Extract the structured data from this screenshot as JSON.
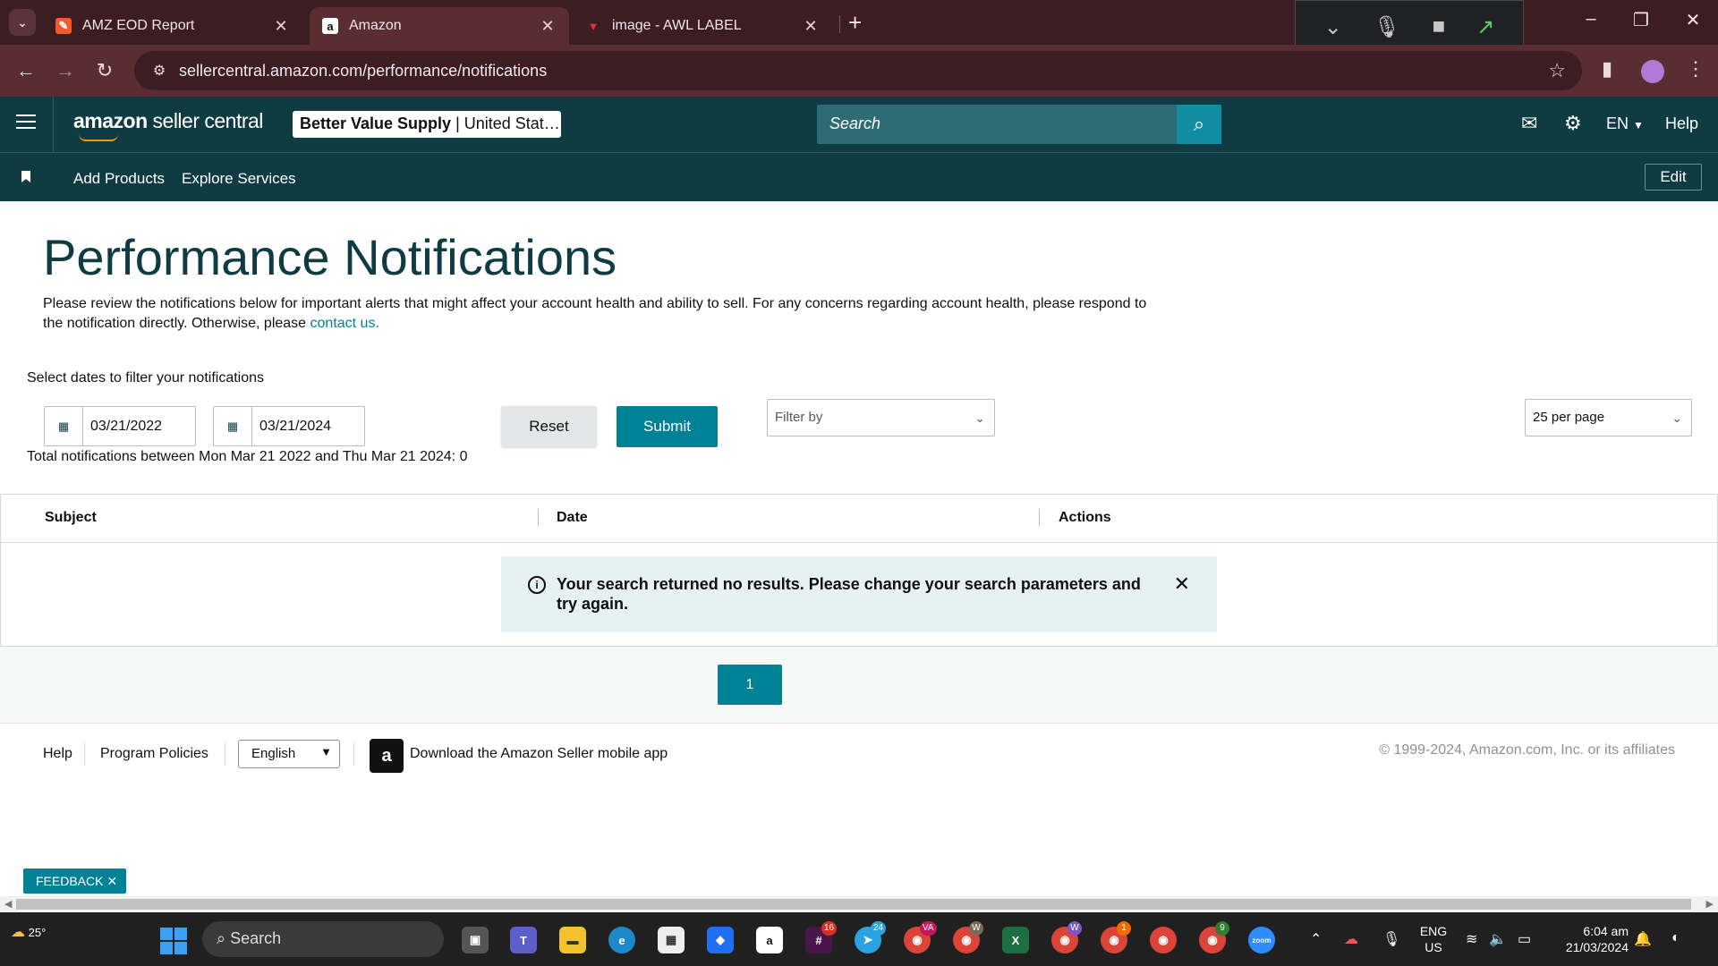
{
  "browser": {
    "tabs": [
      {
        "title": "AMZ EOD Report",
        "active": false
      },
      {
        "title": "Amazon",
        "active": true
      },
      {
        "title": "image - AWL LABEL",
        "active": false
      }
    ],
    "url": "sellercentral.amazon.com/performance/notifications"
  },
  "header": {
    "logo_bold": "amazon",
    "logo_rest": " seller central",
    "store_name": "Better Value Supply",
    "store_region": " | United Stat…",
    "search_placeholder": "Search",
    "language": "EN",
    "help": "Help"
  },
  "subnav": {
    "items": [
      "Add Products",
      "Explore Services"
    ],
    "edit": "Edit"
  },
  "page": {
    "title": "Performance Notifications",
    "intro": "Please review the notifications below for important alerts that might affect your account health and ability to sell. For any concerns regarding account health, please respond to the notification directly. Otherwise, please ",
    "contact_link": "contact us.",
    "filter_label": "Select dates to filter your notifications",
    "date_from": "03/21/2022",
    "date_to": "03/21/2024",
    "reset": "Reset",
    "submit": "Submit",
    "filter_placeholder": "Filter by",
    "per_page": "25 per page",
    "total": "Total notifications between Mon Mar 21 2022 and Thu Mar 21 2024: 0"
  },
  "table": {
    "columns": [
      "Subject",
      "Date",
      "Actions"
    ],
    "empty_message": "Your search returned no results. Please change your search parameters and try again."
  },
  "pagination": {
    "current": "1"
  },
  "footer": {
    "help": "Help",
    "policies": "Program Policies",
    "language": "English",
    "app_download": "Download the Amazon Seller mobile app",
    "copyright": "© 1999-2024, Amazon.com, Inc. or its affiliates"
  },
  "feedback": "FEEDBACK ✕",
  "taskbar": {
    "weather": "25°",
    "search": "Search",
    "badges": [
      "16",
      "24",
      "VA",
      "W",
      "W",
      "1",
      "9"
    ],
    "lang_top": "ENG",
    "lang_bottom": "US",
    "time": "6:04 am",
    "date": "21/03/2024"
  },
  "colors": {
    "header_bg": "#0f3b43",
    "accent_teal": "#008296",
    "browser_frame": "#3b1d22"
  }
}
